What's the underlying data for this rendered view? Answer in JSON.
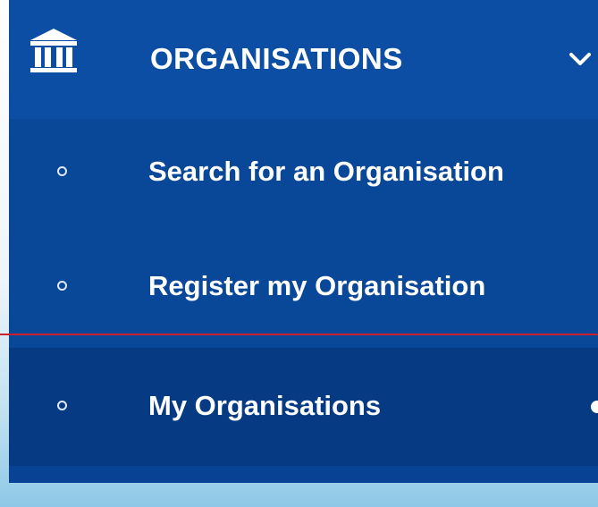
{
  "menu": {
    "header": {
      "label": "ORGANISATIONS",
      "icon": "bank-building-icon",
      "toggle_icon": "chevron-down-icon",
      "expanded": true
    },
    "items": [
      {
        "label": "Search for an Organisation",
        "icon": "circle-bullet-icon",
        "active": false
      },
      {
        "label": "Register my Organisation",
        "icon": "circle-bullet-icon",
        "active": false
      },
      {
        "label": "My Organisations",
        "icon": "circle-bullet-icon",
        "active": true
      }
    ]
  },
  "colors": {
    "menu_background": "#0a4a9f",
    "header_background": "#0c4ea3",
    "active_item_background": "#063a83",
    "text": "#ffffff",
    "highlight_line": "#cc1f2a"
  }
}
